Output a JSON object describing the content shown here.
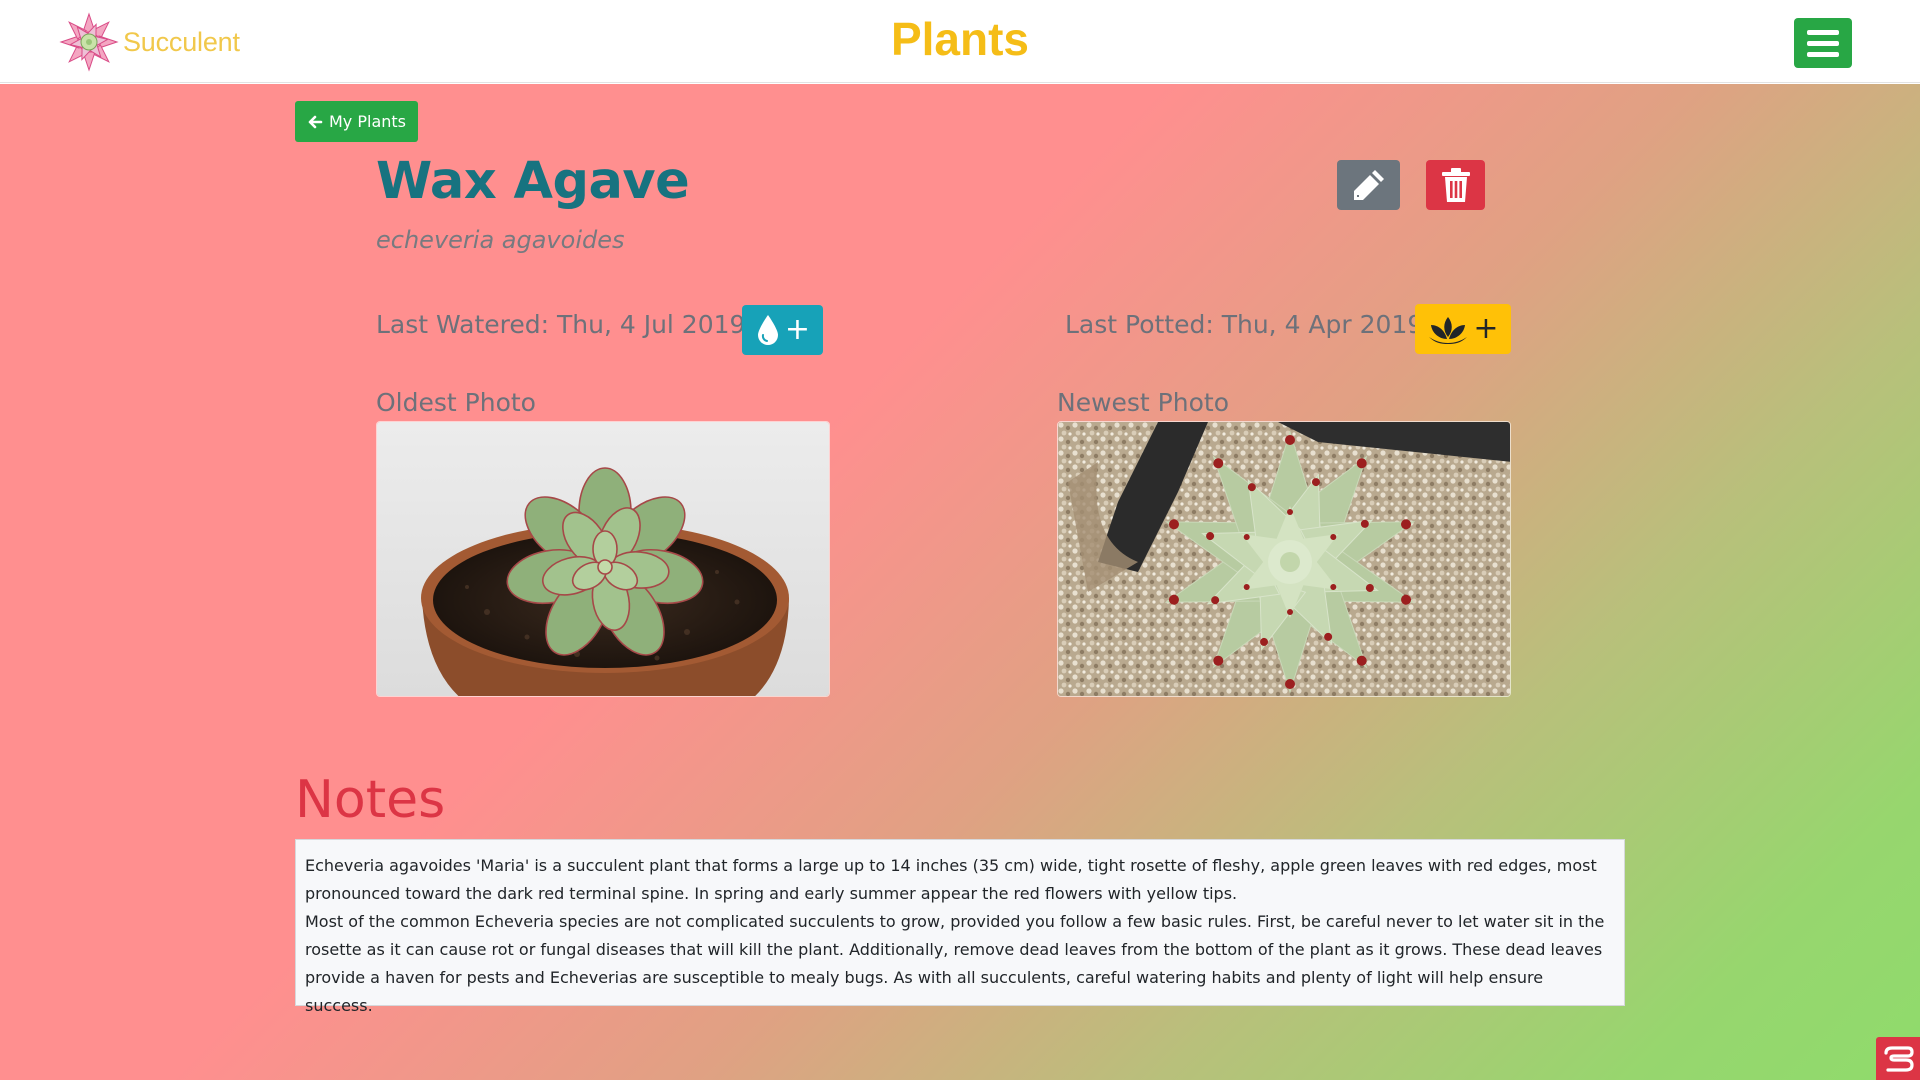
{
  "navbar": {
    "brand_text": "Succulent",
    "brand_icon": "succulent-logo",
    "heading": "Plants",
    "menu_icon": "hamburger-icon"
  },
  "plant": {
    "back_label": "My Plants",
    "back_icon": "arrow-left-icon",
    "name": "Wax Agave",
    "latin_name": "echeveria agavoides",
    "edit_icon": "pencil-icon",
    "delete_icon": "trash-icon",
    "last_watered_label": "Last Watered: Thu, 4 Jul 2019",
    "water_icon": "water-drop-icon",
    "last_potted_label": "Last Potted: Thu, 4 Apr 2019",
    "pot_icon": "lotus-icon",
    "plus": "+"
  },
  "photos": {
    "oldest_label": "Oldest Photo",
    "newest_label": "Newest Photo"
  },
  "notes": {
    "title": "Notes",
    "paragraphs": [
      "Echeveria agavoides 'Maria' is a succulent plant that forms a large up to 14 inches (35 cm) wide, tight rosette of fleshy, apple green leaves with red edges, most pronounced toward the dark red terminal spine. In spring and early summer appear the red flowers with yellow tips.",
      "Most of the common Echeveria species are not complicated succulents to grow, provided you follow a few basic rules. First, be careful never to let water sit in the rosette as it can cause rot or fungal diseases that will kill the plant. Additionally, remove dead leaves from the bottom of the plant as it grows. These dead leaves provide a haven for pests and Echeverias are susceptible to mealy bugs. As with all succulents, careful watering habits and plenty of light will help ensure success."
    ]
  },
  "colors": {
    "brand_yellow": "#f5bd17",
    "success": "#28a745",
    "info": "#17a2b8",
    "warning": "#ffc107",
    "danger": "#dc3545",
    "secondary": "#6c757d",
    "title_teal": "#177380"
  }
}
